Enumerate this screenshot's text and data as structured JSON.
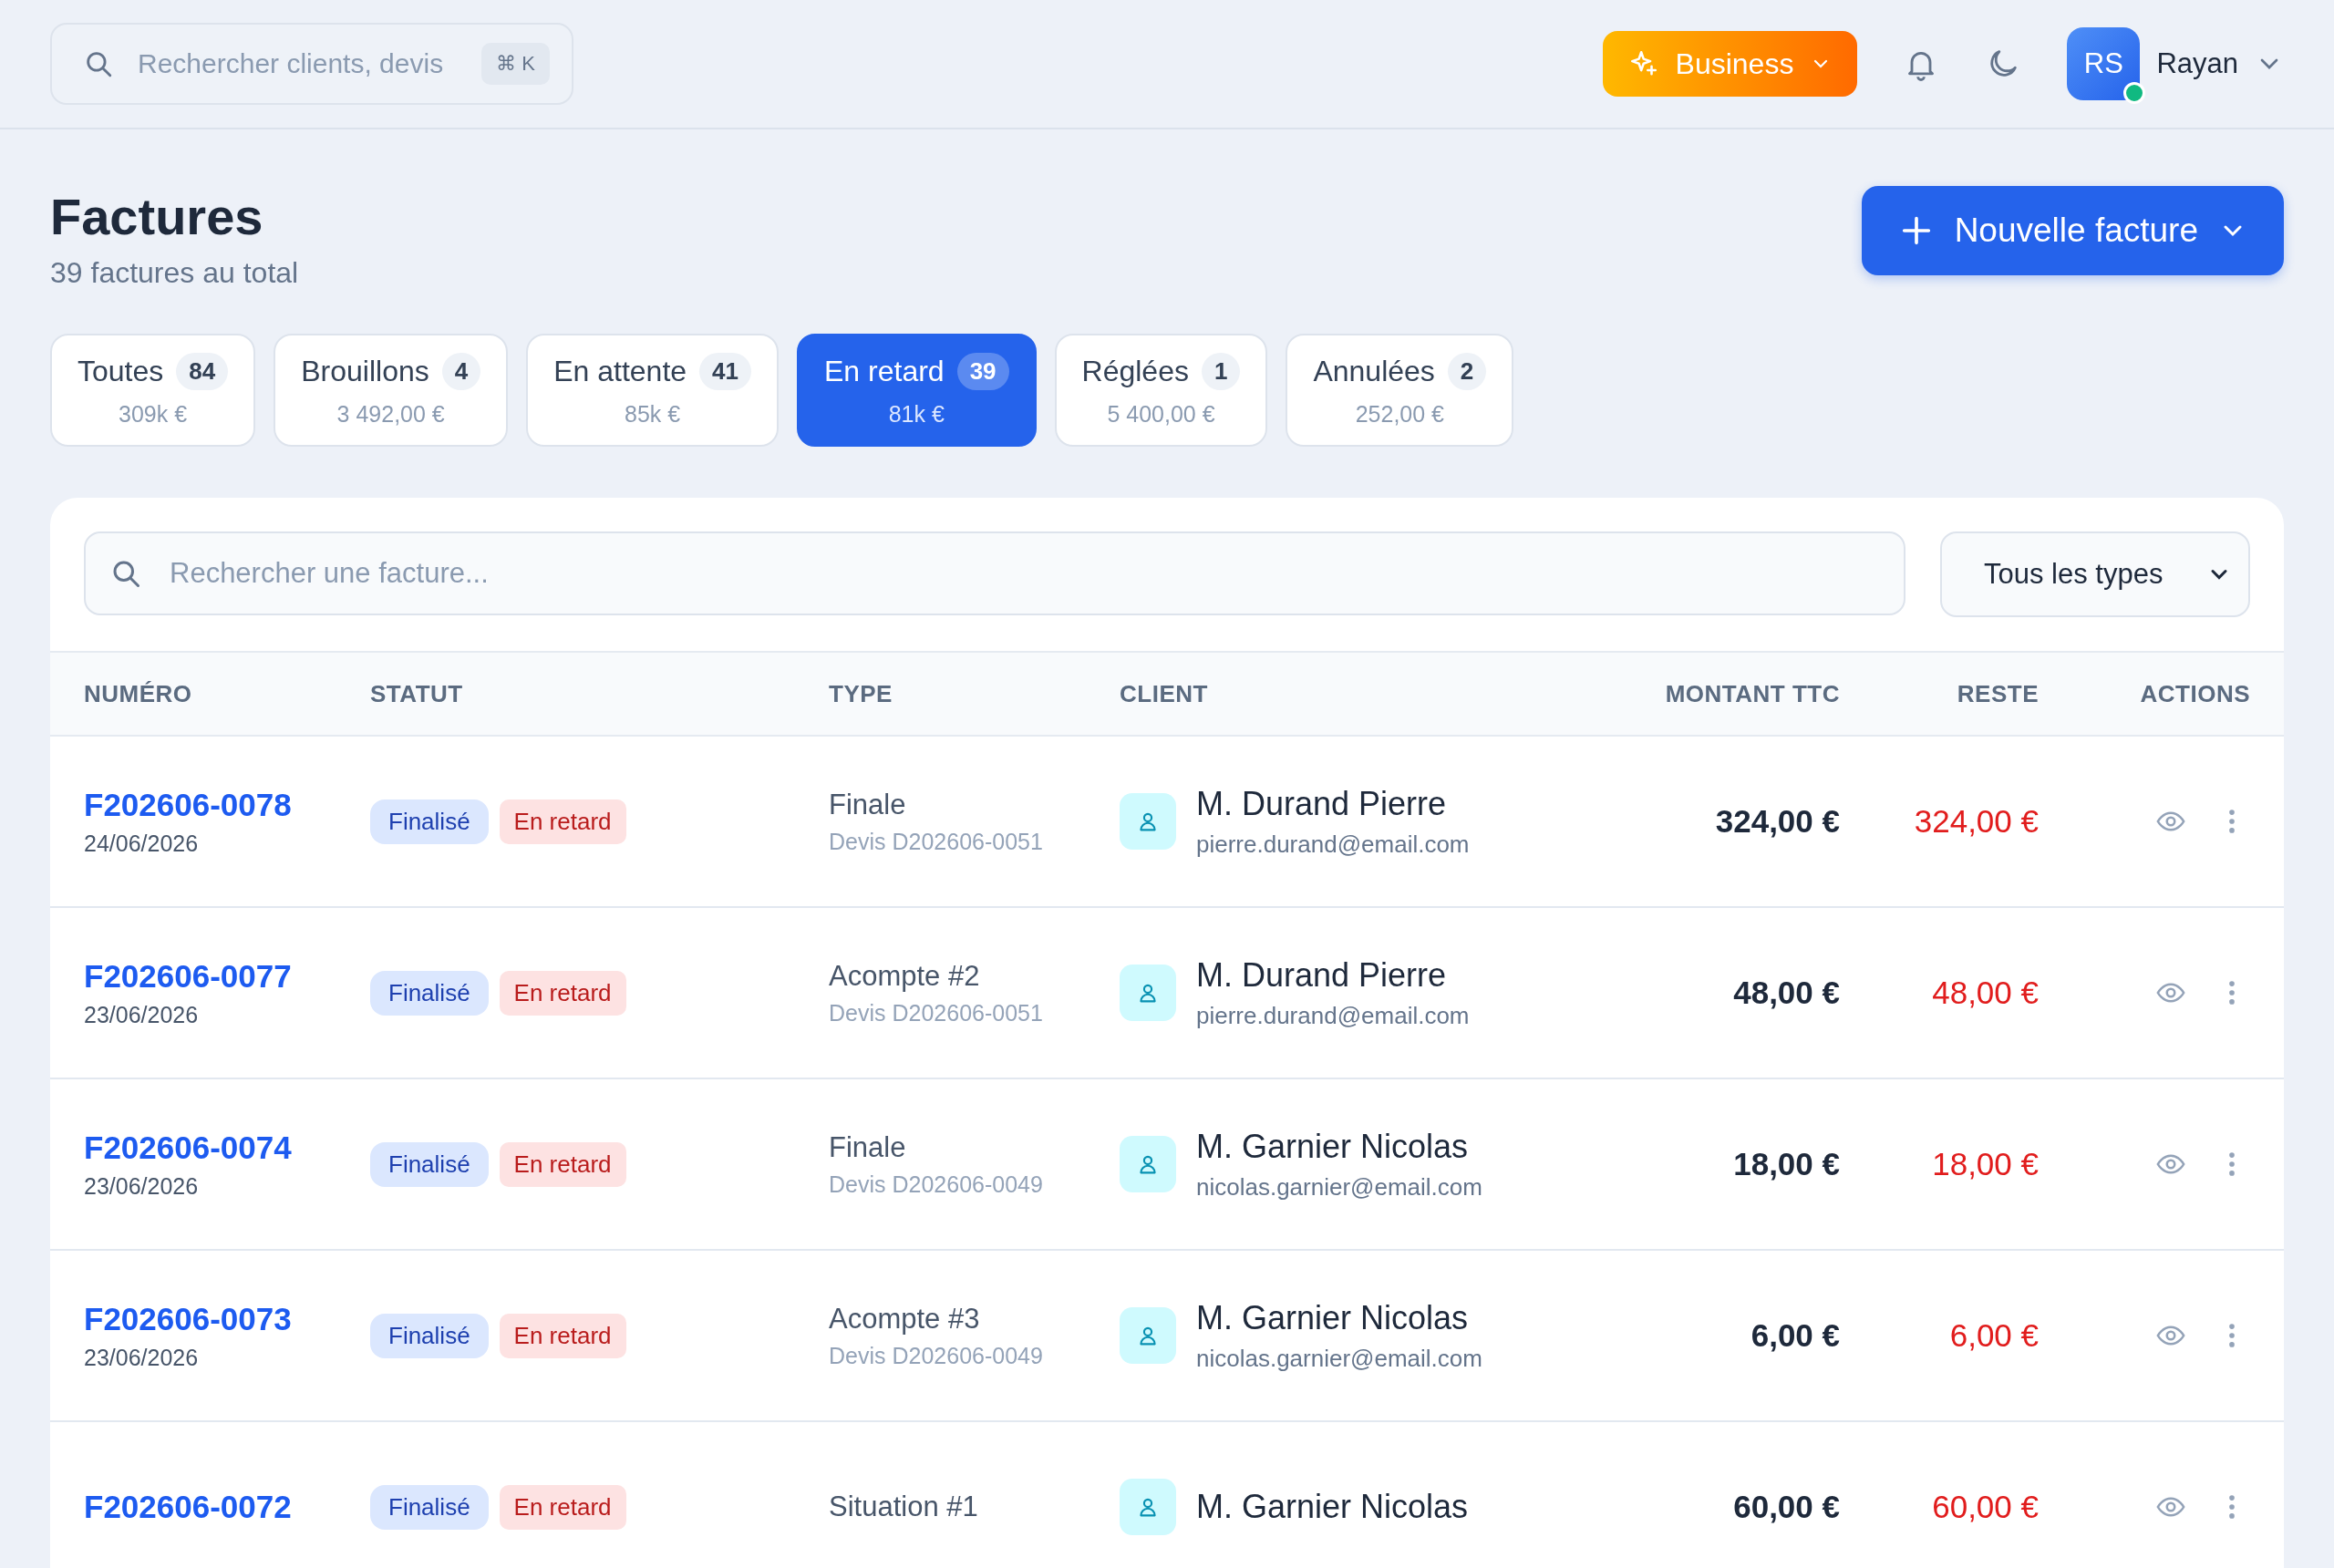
{
  "topbar": {
    "search": {
      "placeholder": "Rechercher clients, devis",
      "shortcut": "⌘ K"
    },
    "plan": "Business",
    "user": {
      "initials": "RS",
      "name": "Rayan",
      "online": true
    }
  },
  "header": {
    "title": "Factures",
    "subtitle": "39 factures au total",
    "new_button": "Nouvelle facture"
  },
  "tabs": [
    {
      "label": "Toutes",
      "count": "84",
      "amount": "309k €",
      "selected": false
    },
    {
      "label": "Brouillons",
      "count": "4",
      "amount": "3 492,00 €",
      "selected": false
    },
    {
      "label": "En attente",
      "count": "41",
      "amount": "85k €",
      "selected": false
    },
    {
      "label": "En retard",
      "count": "39",
      "amount": "81k €",
      "selected": true
    },
    {
      "label": "Réglées",
      "count": "1",
      "amount": "5 400,00 €",
      "selected": false
    },
    {
      "label": "Annulées",
      "count": "2",
      "amount": "252,00 €",
      "selected": false
    }
  ],
  "table": {
    "search": {
      "placeholder": "Rechercher une facture..."
    },
    "type_filter": "Tous les types",
    "columns": [
      "NUMÉRO",
      "STATUT",
      "TYPE",
      "CLIENT",
      "MONTANT TTC",
      "RESTE",
      "ACTIONS"
    ],
    "rows": [
      {
        "number": "F202606-0078",
        "date": "24/06/2026",
        "statuses": [
          {
            "label": "Finalisé",
            "kind": "info"
          },
          {
            "label": "En retard",
            "kind": "danger"
          }
        ],
        "type": "Finale",
        "quote": "Devis D202606-0051",
        "client": "M. Durand Pierre",
        "email": "pierre.durand@email.com",
        "amount": "324,00 €",
        "remaining": "324,00 €"
      },
      {
        "number": "F202606-0077",
        "date": "23/06/2026",
        "statuses": [
          {
            "label": "Finalisé",
            "kind": "info"
          },
          {
            "label": "En retard",
            "kind": "danger"
          }
        ],
        "type": "Acompte #2",
        "quote": "Devis D202606-0051",
        "client": "M. Durand Pierre",
        "email": "pierre.durand@email.com",
        "amount": "48,00 €",
        "remaining": "48,00 €"
      },
      {
        "number": "F202606-0074",
        "date": "23/06/2026",
        "statuses": [
          {
            "label": "Finalisé",
            "kind": "info"
          },
          {
            "label": "En retard",
            "kind": "danger"
          }
        ],
        "type": "Finale",
        "quote": "Devis D202606-0049",
        "client": "M. Garnier Nicolas",
        "email": "nicolas.garnier@email.com",
        "amount": "18,00 €",
        "remaining": "18,00 €"
      },
      {
        "number": "F202606-0073",
        "date": "23/06/2026",
        "statuses": [
          {
            "label": "Finalisé",
            "kind": "info"
          },
          {
            "label": "En retard",
            "kind": "danger"
          }
        ],
        "type": "Acompte #3",
        "quote": "Devis D202606-0049",
        "client": "M. Garnier Nicolas",
        "email": "nicolas.garnier@email.com",
        "amount": "6,00 €",
        "remaining": "6,00 €"
      },
      {
        "number": "F202606-0072",
        "statuses": [
          {
            "label": "Finalisé",
            "kind": "info"
          },
          {
            "label": "En retard",
            "kind": "danger"
          }
        ],
        "type": "Situation #1",
        "client": "M. Garnier Nicolas",
        "amount": "60,00 €",
        "remaining": "60,00 €"
      }
    ]
  }
}
